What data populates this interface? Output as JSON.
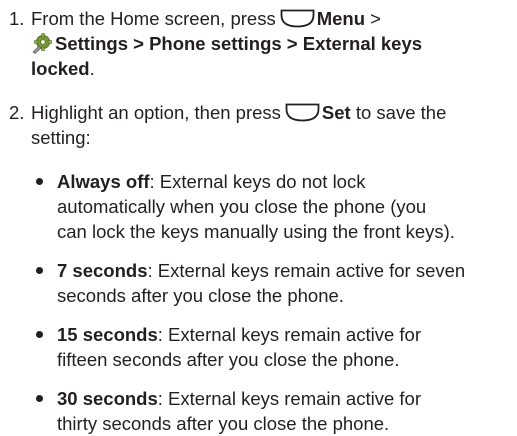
{
  "steps": [
    {
      "number": "1.",
      "line1_pre": "From the Home screen, press",
      "key_icon": "menu-softkey-icon",
      "line1_bold": "Menu",
      "line1_sep": ">",
      "settings_icon": "settings-gear-icon",
      "line2_bold": "Settings > Phone settings > External keys",
      "line3_bold": "locked",
      "line3_end": "."
    },
    {
      "number": "2.",
      "line1_pre": "Highlight an option, then press",
      "key_icon": "set-softkey-icon",
      "line1_bold": "Set",
      "line1_post": "to save the",
      "line2": "setting:"
    }
  ],
  "options": [
    {
      "term": "Always off",
      "lines": [
        ": External keys do not lock",
        "automatically when you close the phone (you",
        "can lock the keys manually using the front keys)."
      ]
    },
    {
      "term": "7 seconds",
      "lines": [
        ": External keys remain active for seven",
        "seconds after you close the phone."
      ]
    },
    {
      "term": "15 seconds",
      "lines": [
        ": External keys remain active for",
        "fifteen seconds after you close the phone."
      ]
    },
    {
      "term": "30 seconds",
      "lines": [
        ": External keys remain active for",
        "thirty seconds after you close the phone."
      ]
    }
  ]
}
